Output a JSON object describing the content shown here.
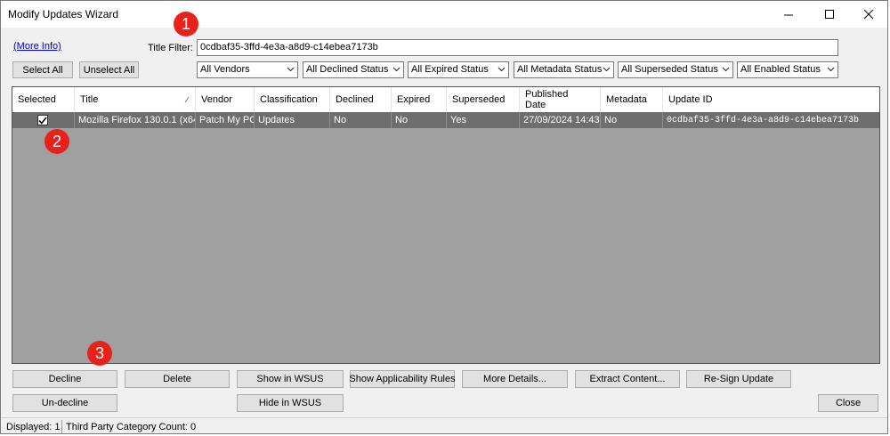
{
  "window": {
    "title": "Modify Updates Wizard"
  },
  "more_info": "(More Info)",
  "title_filter": {
    "label": "Title Filter:",
    "value": "0cdbaf35-3ffd-4e3a-a8d9-c14ebea7173b"
  },
  "select_all": "Select All",
  "unselect_all": "Unselect All",
  "filters": [
    "All Vendors",
    "All Declined Status",
    "All Expired Status",
    "All Metadata Status",
    "All Superseded Status",
    "All Enabled Status"
  ],
  "grid": {
    "columns": [
      "Selected",
      "Title",
      "Vendor",
      "Classification",
      "Declined",
      "Expired",
      "Superseded",
      "Published",
      "Date",
      "Metadata",
      "Update ID"
    ],
    "rows": [
      {
        "selected": true,
        "title": "Mozilla Firefox 130.0.1 (x64...",
        "vendor": "Patch My PC",
        "classification": "Updates",
        "declined": "No",
        "expired": "No",
        "superseded": "Yes",
        "published": "27/09/2024 14:43",
        "metadata": "No",
        "update_id": "0cdbaf35-3ffd-4e3a-a8d9-c14ebea7173b"
      }
    ]
  },
  "buttons": {
    "decline": "Decline",
    "delete": "Delete",
    "show_wsus": "Show in WSUS",
    "show_rules": "Show Applicability Rules",
    "more_details": "More Details...",
    "extract": "Extract Content...",
    "resign": "Re-Sign Update",
    "undecline": "Un-decline",
    "hide_wsus": "Hide in WSUS",
    "close": "Close"
  },
  "status": {
    "displayed": "Displayed: 1",
    "category_count": "Third Party Category Count: 0"
  },
  "callouts": [
    "1",
    "2",
    "3"
  ],
  "colors": {
    "callout": "#e8211a",
    "selected_row": "#6e6e6e",
    "grid_bg": "#a0a0a0",
    "link": "#0000ee"
  }
}
